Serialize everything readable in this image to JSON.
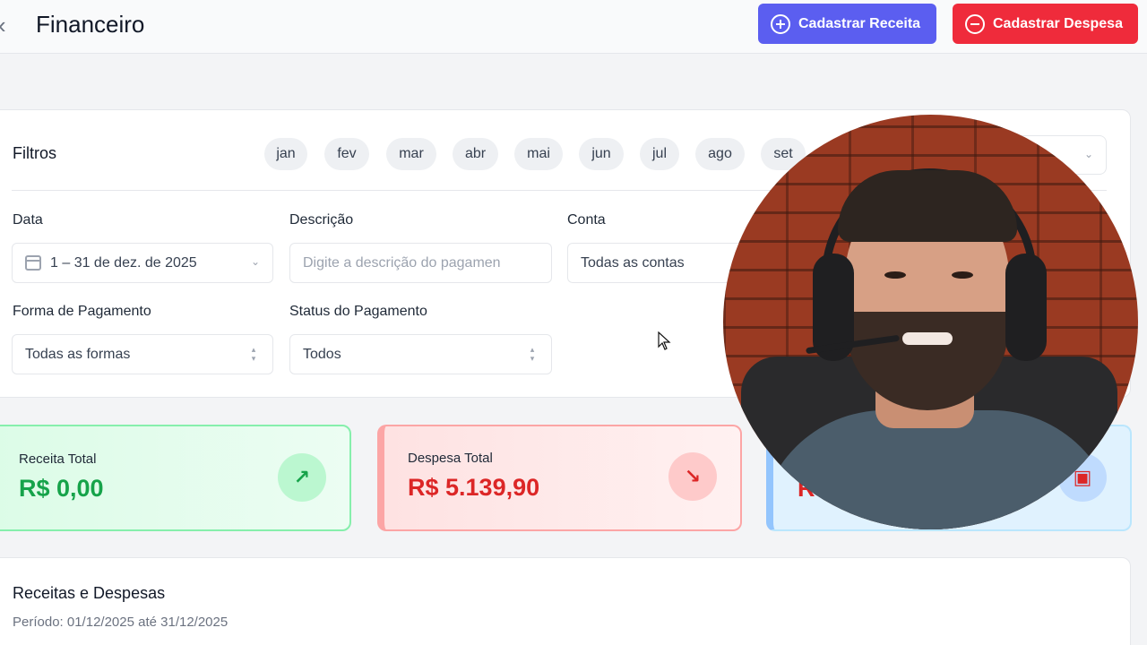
{
  "header": {
    "back_icon": "chevron-left-icon",
    "title": "Financeiro",
    "btn_receita": "Cadastrar Receita",
    "btn_despesa": "Cadastrar Despesa"
  },
  "filters": {
    "title": "Filtros",
    "months": [
      "jan",
      "fev",
      "mar",
      "abr",
      "mai",
      "jun",
      "jul",
      "ago",
      "set"
    ],
    "data_label": "Data",
    "data_value": "1 – 31 de dez. de 2025",
    "descricao_label": "Descrição",
    "descricao_placeholder": "Digite a descrição do pagamen",
    "conta_label": "Conta",
    "conta_value": "Todas as contas",
    "forma_label": "Forma de Pagamento",
    "forma_value": "Todas as formas",
    "status_label": "Status do Pagamento",
    "status_value": "Todos"
  },
  "cards": {
    "receita_label": "Receita Total",
    "receita_value": "R$ 0,00",
    "despesa_label": "Despesa Total",
    "despesa_value": "R$ 5.139,90",
    "saldo_value_partial": "R"
  },
  "report": {
    "title": "Receitas e Despesas",
    "period": "Período: 01/12/2025 até 31/12/2025"
  },
  "colors": {
    "primary": "#5b5ef0",
    "danger": "#ef2b3b",
    "income": "#16a34a",
    "expense": "#dc2626"
  }
}
